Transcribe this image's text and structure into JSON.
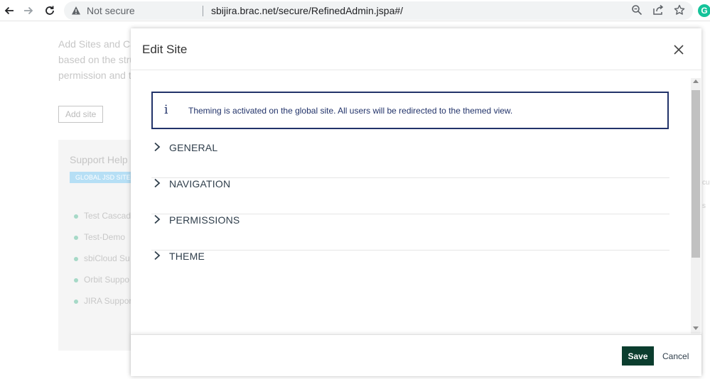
{
  "browser": {
    "not_secure": "Not secure",
    "url": "sbijira.brac.net/secure/RefinedAdmin.jspa#/",
    "extension_letter": "G"
  },
  "background": {
    "intro_lines": [
      "Add Sites and Ca",
      "based on the stru",
      "permission and th"
    ],
    "add_site_label": "Add site",
    "card_title": "Support Help",
    "badge": "GLOBAL JSD SITE",
    "sites": [
      "Test Cascade",
      "Test-Demo",
      "sbiCloud Su",
      "Orbit Suppo",
      "JIRA Support"
    ],
    "right_fragments": [
      "cu",
      "s"
    ]
  },
  "modal": {
    "title": "Edit Site",
    "info": {
      "icon": "i",
      "text": "Theming is activated on the global site. All users will be redirected to the themed view."
    },
    "sections": [
      {
        "label": "GENERAL"
      },
      {
        "label": "NAVIGATION"
      },
      {
        "label": "PERMISSIONS"
      },
      {
        "label": "THEME"
      }
    ],
    "save_label": "Save",
    "cancel_label": "Cancel"
  },
  "colors": {
    "primary": "#0b3d2e",
    "info_border": "#22336a",
    "badge": "#b6dff5"
  }
}
